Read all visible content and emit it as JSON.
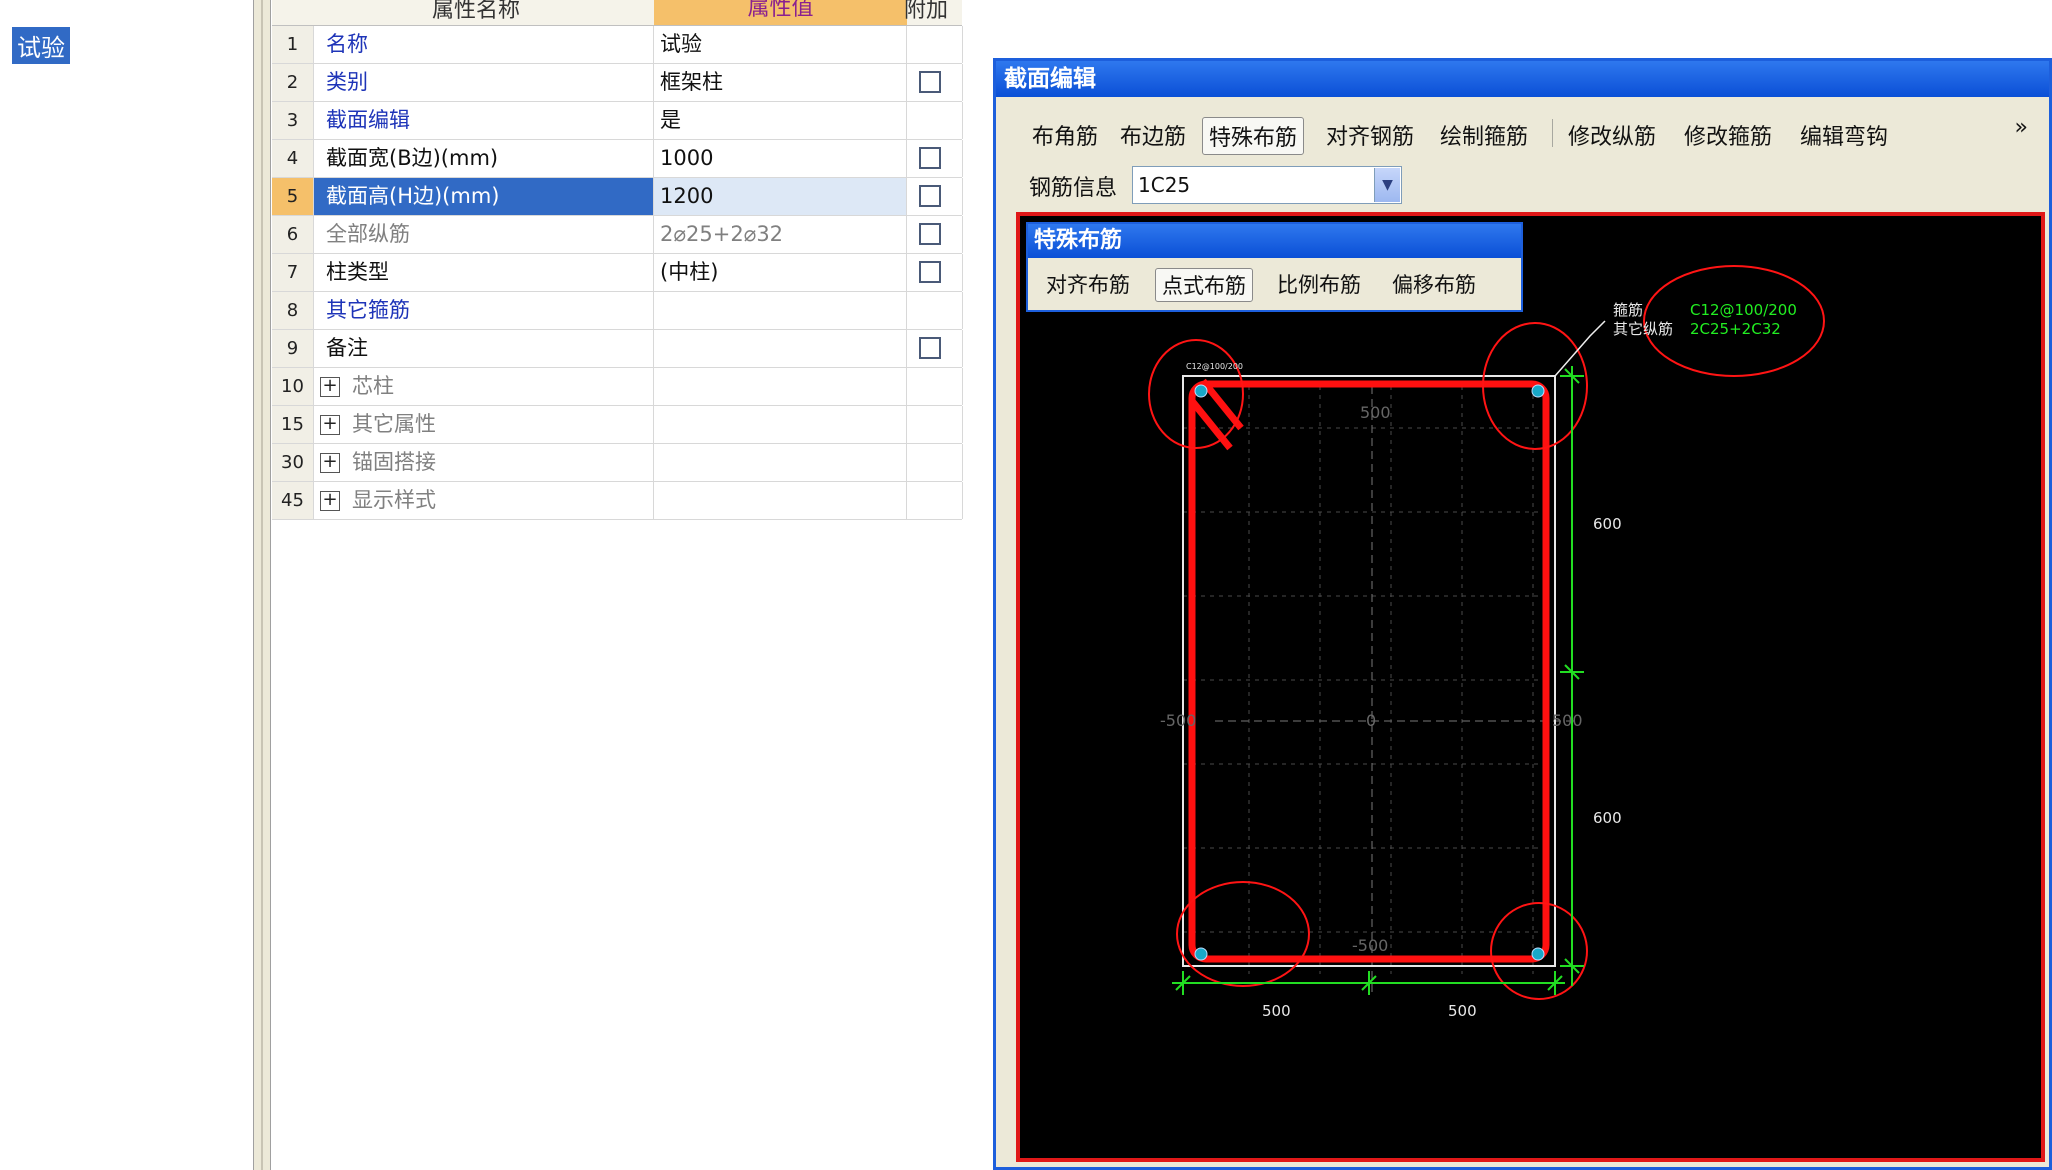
{
  "tree": {
    "selected_item": "试验"
  },
  "grid": {
    "headers": {
      "name": "属性名称",
      "value": "属性值",
      "extra": "附加"
    },
    "rows": [
      {
        "no": "1",
        "name": "名称",
        "value": "试验",
        "style": "blue",
        "checkbox": false
      },
      {
        "no": "2",
        "name": "类别",
        "value": "框架柱",
        "style": "blue",
        "checkbox": true
      },
      {
        "no": "3",
        "name": "截面编辑",
        "value": "是",
        "style": "blue",
        "checkbox": false
      },
      {
        "no": "4",
        "name": "截面宽(B边)(mm)",
        "value": "1000",
        "style": "dark",
        "checkbox": true
      },
      {
        "no": "5",
        "name": "截面高(H边)(mm)",
        "value": "1200",
        "style": "dark",
        "checkbox": true,
        "selected": true
      },
      {
        "no": "6",
        "name": "全部纵筋",
        "value": "2⌀25+2⌀32",
        "style": "gray",
        "checkbox": true
      },
      {
        "no": "7",
        "name": "柱类型",
        "value": "(中柱)",
        "style": "dark",
        "checkbox": true
      },
      {
        "no": "8",
        "name": "其它箍筋",
        "value": "",
        "style": "blue",
        "checkbox": false
      },
      {
        "no": "9",
        "name": "备注",
        "value": "",
        "style": "dark",
        "checkbox": true
      },
      {
        "no": "10",
        "name": "芯柱",
        "value": "",
        "style": "gray",
        "checkbox": false,
        "expandable": true
      },
      {
        "no": "15",
        "name": "其它属性",
        "value": "",
        "style": "gray",
        "checkbox": false,
        "expandable": true
      },
      {
        "no": "30",
        "name": "锚固搭接",
        "value": "",
        "style": "gray",
        "checkbox": false,
        "expandable": true
      },
      {
        "no": "45",
        "name": "显示样式",
        "value": "",
        "style": "gray",
        "checkbox": false,
        "expandable": true
      }
    ]
  },
  "dialog": {
    "title": "截面编辑",
    "toolbar": {
      "corner": "布角筋",
      "edge": "布边筋",
      "special": "特殊布筋",
      "align": "对齐钢筋",
      "draw_stirrup": "绘制箍筋",
      "edit_long": "修改纵筋",
      "edit_stirrup": "修改箍筋",
      "edit_hook": "编辑弯钩",
      "more": "»"
    },
    "info_label": "钢筋信息",
    "info_value": "1C25",
    "sub": {
      "title": "特殊布筋",
      "align": "对齐布筋",
      "point": "点式布筋",
      "ratio": "比例布筋",
      "offset": "偏移布筋"
    },
    "drawing": {
      "axis_labels": {
        "top": "500",
        "left": "-500",
        "center": "0",
        "right": "500",
        "bottom": "-500"
      },
      "dims": {
        "right_upper": "600",
        "right_lower": "600",
        "bottom_left": "500",
        "bottom_right": "500"
      },
      "legend": {
        "stirrup_label": "箍筋",
        "other_long_label": "其它纵筋",
        "stirrup_value": "C12@100/200",
        "long_value": "2C25+2C32"
      },
      "corner_tag": "C12@100/200"
    }
  },
  "colors": {
    "selection": "#316ac5",
    "accent": "#f5c06a",
    "dialog_blue": "#1d5fdc",
    "rebar_red": "#ff1010",
    "dim_green": "#22dd22"
  }
}
